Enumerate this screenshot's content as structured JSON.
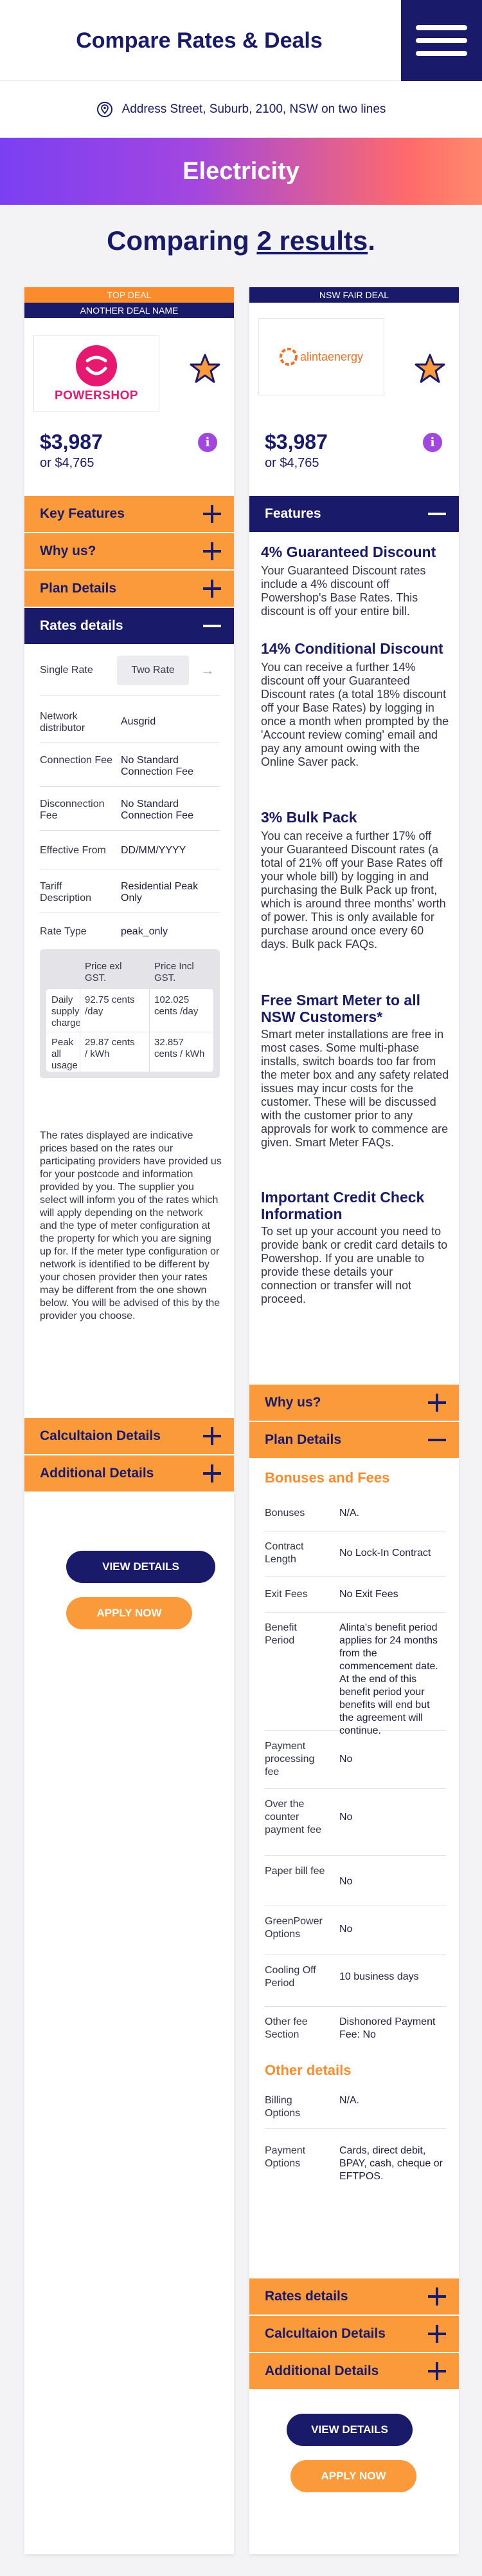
{
  "header": {
    "title": "Compare Rates & Deals",
    "menu_icon": "hamburger-icon"
  },
  "address": {
    "icon": "location-pin-icon",
    "text": "Address Street, Suburb, 2100, NSW on two lines"
  },
  "banner": {
    "label": "Electricity"
  },
  "compare": {
    "prefix": "Comparing ",
    "count_text": "2 results",
    "suffix": "."
  },
  "colors": {
    "navy": "#1a1a6b",
    "orange": "#fb9a3a",
    "purple": "#a246e0",
    "powershop": "#e6186f"
  },
  "left": {
    "tag": "TOP DEAL",
    "deal_name": "ANOTHER DEAL NAME",
    "logo_text": "POWERSHOP",
    "price": "$3,987",
    "price_sub": "or $4,765",
    "acc_key_features": "Key Features",
    "acc_why_us": "Why us?",
    "acc_plan_details": "Plan Details",
    "acc_rates_details": "Rates details",
    "rate_rows": [
      {
        "k": "Single Rate",
        "v": "Two Rate"
      },
      {
        "k": "Network distributor",
        "v": "Ausgrid"
      },
      {
        "k": "Connection Fee",
        "v": "No Standard Connection Fee"
      },
      {
        "k": "Disconnection Fee",
        "v": "No Standard Connection Fee"
      },
      {
        "k": "Effective From",
        "v": "DD/MM/YYYY"
      },
      {
        "k": "Tariff Description",
        "v": "Residential Peak Only"
      },
      {
        "k": "Rate Type",
        "v": "peak_only"
      }
    ],
    "supply": {
      "head1": "Price exl GST.",
      "head2": "Price Incl GST.",
      "row1_label": "Daily supply charge",
      "row1_v1": "92.75 cents /day",
      "row1_v2": "102.025 cents /day",
      "row2_label": "Peak all usage",
      "row2_v1": "29.87 cents / kWh",
      "row2_v2": "32.857 cents / kWh"
    },
    "disclaimer": "The rates displayed are indicative prices based on the rates our participating providers have provided us for your postcode and information provided by you. The supplier you select will inform you of the rates which will apply depending on the network and the type of meter configuration at the property for which you are signing up for. If the meter type configuration or network is identified to be different by your chosen provider then your rates may be different from the one shown below. You will be advised of this by the provider you choose.",
    "acc_calculation": "Calcultaion Details",
    "acc_additional": "Additional Details",
    "btn_view": "VIEW DETAILS",
    "btn_apply": "APPLY NOW"
  },
  "right": {
    "tag": "NSW FAIR DEAL",
    "logo_text": "alintaenergy",
    "price": "$3,987",
    "price_sub": "or $4,765",
    "acc_features": "Features",
    "features": [
      {
        "h": "4% Guaranteed Discount",
        "p": "Your Guaranteed Discount rates include a 4% discount off Powershop's Base Rates. This discount is off your entire bill."
      },
      {
        "h": "14% Conditional Discount",
        "p": "You can receive a further 14% discount off your Guaranteed Discount rates (a total 18% discount off your Base Rates) by logging in once a month when prompted by the 'Account review coming' email and pay any amount owing with the Online Saver pack."
      },
      {
        "h": "3% Bulk Pack",
        "p": "You can receive a further 17% off your Guaranteed Discount rates (a total of 21% off your Base Rates off your whole bill) by logging in and purchasing the Bulk Pack up front, which is around three months' worth of power. This is only available for purchase around once every 60 days. Bulk pack FAQs."
      },
      {
        "h": "Free Smart Meter to all NSW Customers*",
        "p": "Smart meter installations are free in most cases. Some multi-phase installs, switch boards too far from the meter box and any safety related issues may incur costs for the customer. These will be discussed with the customer prior to any approvals for work to commence are given. Smart Meter FAQs."
      },
      {
        "h": "Important Credit Check Information",
        "p": "To set up your account you need to provide bank or credit card details to Powershop. If you are unable to provide these details your connection or transfer will not proceed."
      }
    ],
    "acc_why_us": "Why us?",
    "acc_plan_details": "Plan Details",
    "bonuses_title": "Bonuses and Fees",
    "bonus_rows": [
      {
        "k": "Bonuses",
        "v": "N/A."
      },
      {
        "k": "Contract Length",
        "v": "No Lock-In Contract"
      },
      {
        "k": "Exit Fees",
        "v": "No Exit Fees"
      },
      {
        "k": "Benefit Period",
        "v": "Alinta's benefit period applies for 24 months from the commencement date. At the end of this benefit period your benefits will end but the agreement will continue."
      },
      {
        "k": "Payment processing fee",
        "v": "No"
      },
      {
        "k": "Over the counter payment fee",
        "v": "No"
      },
      {
        "k": "Paper bill fee",
        "v": "No"
      },
      {
        "k": "GreenPower Options",
        "v": "No"
      },
      {
        "k": "Cooling Off Period",
        "v": "10 business days"
      },
      {
        "k": "Other fee Section",
        "v": "Dishonored Payment Fee: No"
      }
    ],
    "other_title": "Other details",
    "other_rows": [
      {
        "k": "Billing Options",
        "v": "N/A."
      },
      {
        "k": "Payment Options",
        "v": "Cards, direct debit, BPAY, cash, cheque or EFTPOS."
      }
    ],
    "acc_rates": "Rates details",
    "acc_calculation": "Calcultaion Details",
    "acc_additional": "Additional Details",
    "btn_view": "VIEW DETAILS",
    "btn_apply": "APPLY NOW"
  }
}
